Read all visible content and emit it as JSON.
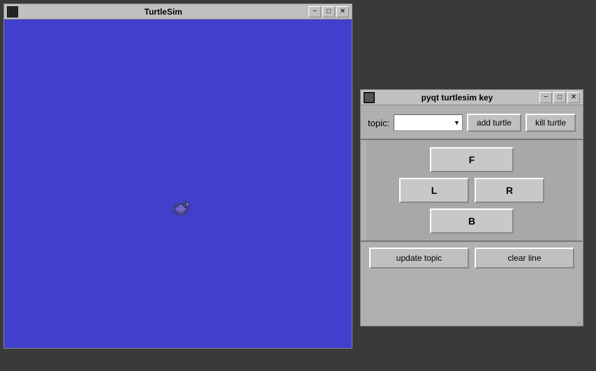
{
  "turtlesim": {
    "title": "TurtleSim",
    "bg_color": "#4040cc",
    "min_btn": "−",
    "max_btn": "□",
    "close_btn": "✕",
    "turtle_alt": "turtle"
  },
  "pyqt": {
    "title": "pyqt turtlesim key",
    "min_btn": "−",
    "max_btn": "□",
    "close_btn": "✕",
    "topic_label": "topic:",
    "add_turtle_btn": "add turtle",
    "kill_turtle_btn": "kill turtle",
    "forward_btn": "F",
    "left_btn": "L",
    "right_btn": "R",
    "backward_btn": "B",
    "update_topic_btn": "update topic",
    "clear_line_btn": "clear line"
  }
}
